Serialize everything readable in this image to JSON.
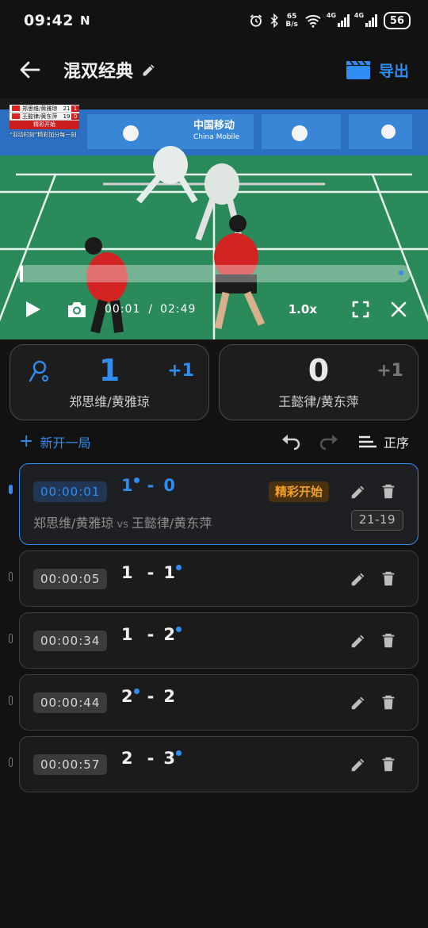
{
  "status_bar": {
    "time": "09:42",
    "nfc_label": "N",
    "net_speed_value": "65",
    "net_speed_unit": "B/s",
    "signal_1": "4G",
    "signal_2": "4G",
    "battery": "56"
  },
  "header": {
    "title": "混双经典",
    "export_label": "导出"
  },
  "video": {
    "scoreboard": {
      "team_a": "郑思维/黄雅琼",
      "team_a_game": "21",
      "team_a_current": "1",
      "team_b": "王懿律/黄东萍",
      "team_b_game": "19",
      "team_b_current": "0",
      "banner": "精彩开始",
      "caption": "“羽动时刻”精彩加分每一刻"
    },
    "sponsor": "中国移动",
    "sponsor_en": "China Mobile",
    "progress": 0.006,
    "current_time": "00:01",
    "separator": "/",
    "total_time": "02:49",
    "speed": "1.0x"
  },
  "teams": [
    {
      "name": "郑思维/黄雅琼",
      "score": "1",
      "plus": "+1",
      "serving": true
    },
    {
      "name": "王懿律/黄东萍",
      "score": "0",
      "plus": "+1",
      "serving": false
    }
  ],
  "actions": {
    "new_game": "新开一局",
    "new_game_plus": "+",
    "sort_label": "正序"
  },
  "records": [
    {
      "time": "00:00:01",
      "a": "1",
      "b": "0",
      "server": "a",
      "active": true,
      "tag": "精彩开始",
      "team_a": "郑思维/黄雅琼",
      "vs": "vs",
      "team_b": "王懿律/黄东萍",
      "game_score": "21-19"
    },
    {
      "time": "00:00:05",
      "a": "1",
      "b": "1",
      "server": "b",
      "active": false
    },
    {
      "time": "00:00:34",
      "a": "1",
      "b": "2",
      "server": "b",
      "active": false
    },
    {
      "time": "00:00:44",
      "a": "2",
      "b": "2",
      "server": "a",
      "active": false
    },
    {
      "time": "00:00:57",
      "a": "2",
      "b": "3",
      "server": "b",
      "active": false
    }
  ],
  "score_dash": "-",
  "colors": {
    "accent": "#2f8cf0",
    "highlight": "#f0a028",
    "background": "#121212"
  }
}
